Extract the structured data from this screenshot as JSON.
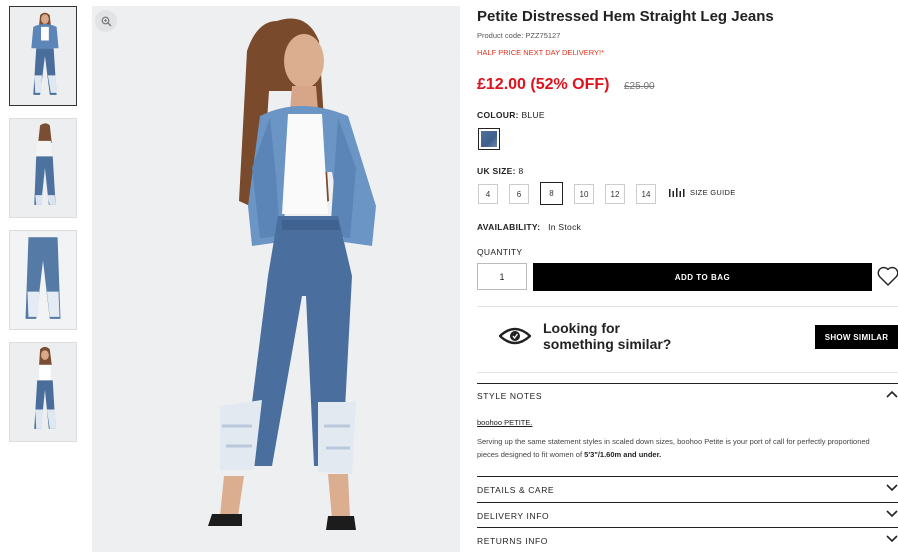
{
  "thumbnails": [
    {
      "label": "front view"
    },
    {
      "label": "back view"
    },
    {
      "label": "flat view"
    },
    {
      "label": "front view alt"
    }
  ],
  "product": {
    "title": "Petite Distressed Hem Straight Leg Jeans",
    "code": "Product code: PZZ75127",
    "promo": "HALF PRICE NEXT DAY DELIVERY!*",
    "price": "£12.00 (52% OFF)",
    "old_price": "£25.00"
  },
  "colour": {
    "label": "COLOUR:",
    "value": "BLUE",
    "swatch_color": "#4a6e9b"
  },
  "size": {
    "label": "UK SIZE:",
    "value": "8",
    "options": [
      "4",
      "6",
      "8",
      "10",
      "12",
      "14"
    ],
    "selected": "8",
    "guide_label": "SIZE GUIDE"
  },
  "availability": {
    "label": "AVAILABILITY:",
    "value": "In Stock"
  },
  "quantity": {
    "label": "QUANTITY",
    "value": "1"
  },
  "actions": {
    "add_to_bag": "ADD TO BAG",
    "wishlist_icon": "heart-icon"
  },
  "similar": {
    "line1": "Looking for",
    "line2": "something similar?",
    "button": "SHOW SIMILAR"
  },
  "accordions": {
    "style_notes": "STYLE NOTES",
    "brand_link": "boohoo PETITE.",
    "notes_text": "Serving up the same statement styles in scaled down sizes, boohoo Petite is your port of call for perfectly proportioned pieces designed to fit women of",
    "notes_bold": "5'3\"/1.60m and under.",
    "details": "DETAILS & CARE",
    "delivery": "DELIVERY INFO",
    "returns": "RETURNS INFO"
  },
  "colors": {
    "price_red": "#e0111a",
    "promo_red": "#e0311c",
    "button_black": "#000000"
  }
}
